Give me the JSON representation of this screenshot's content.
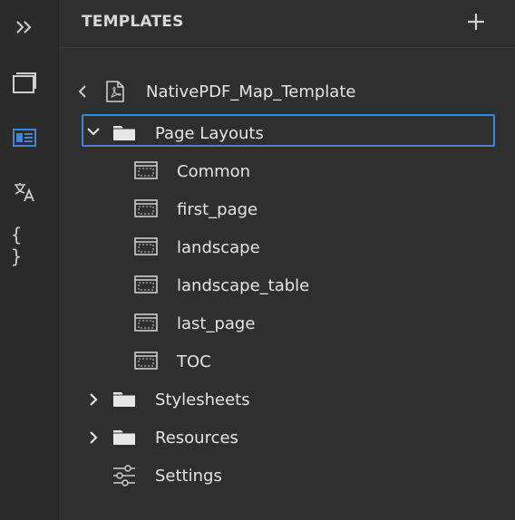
{
  "colors": {
    "accent": "#3f86d8",
    "background": "#2f2f2f",
    "rail": "#2b2b2b",
    "text": "#e4e4e4"
  },
  "rail": {
    "items": [
      {
        "icon": "expand-chevrons-icon"
      },
      {
        "icon": "window-icon"
      },
      {
        "icon": "template-layout-icon",
        "active": true
      },
      {
        "icon": "translate-icon"
      },
      {
        "icon": "braces-icon"
      }
    ]
  },
  "header": {
    "title": "TEMPLATES",
    "add_icon": "plus-icon"
  },
  "tree": {
    "root": {
      "label": "NativePDF_Map_Template",
      "icon": "pdf-file-icon"
    },
    "page_layouts": {
      "label": "Page Layouts",
      "expanded": true,
      "items": [
        "Common",
        "first_page",
        "landscape",
        "landscape_table",
        "last_page",
        "TOC"
      ]
    },
    "stylesheets": {
      "label": "Stylesheets"
    },
    "resources": {
      "label": "Resources"
    },
    "settings": {
      "label": "Settings"
    }
  }
}
